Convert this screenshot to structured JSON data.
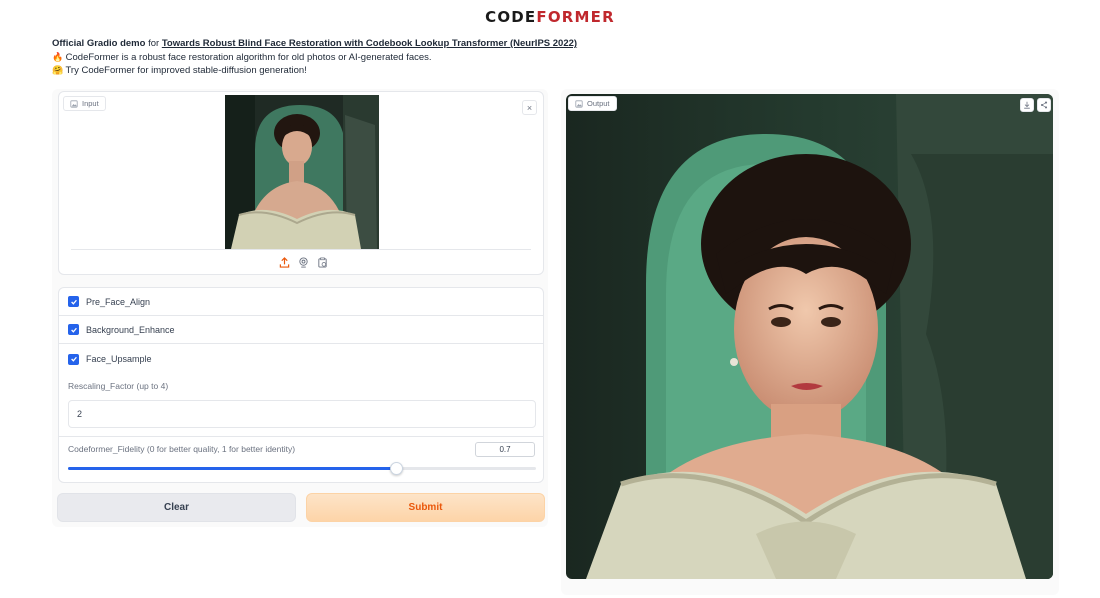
{
  "logo": {
    "part1": "CODE",
    "part2": "FORMER"
  },
  "description": {
    "line1_bold": "Official Gradio demo",
    "line1_text": " for ",
    "line1_link": "Towards Robust Blind Face Restoration with Codebook Lookup Transformer (NeurIPS 2022)",
    "line2_emoji": "🔥",
    "line2_text": "CodeFormer is a robust face restoration algorithm for old photos or AI-generated faces.",
    "line3_emoji": "🤗",
    "line3_text": "Try CodeFormer for improved stable-diffusion generation!"
  },
  "input": {
    "label": "Input",
    "close": "×"
  },
  "options": {
    "pre_face_align": {
      "label": "Pre_Face_Align",
      "checked": true
    },
    "background_enhance": {
      "label": "Background_Enhance",
      "checked": true
    },
    "face_upsample": {
      "label": "Face_Upsample",
      "checked": true
    },
    "rescaling_factor": {
      "label": "Rescaling_Factor (up to 4)",
      "value": "2"
    },
    "fidelity": {
      "label": "Codeformer_Fidelity (0 for better quality, 1 for better identity)",
      "value": "0.7",
      "level": 0.7
    }
  },
  "buttons": {
    "clear": "Clear",
    "submit": "Submit"
  },
  "output": {
    "label": "Output"
  },
  "colors": {
    "accent_blue": "#2563eb",
    "submit_text": "#ea580c",
    "logo_red": "#c0282d"
  },
  "icons": [
    "image-icon",
    "close-icon",
    "upload-icon",
    "webcam-icon",
    "clipboard-icon",
    "download-icon",
    "share-icon",
    "check-icon"
  ]
}
